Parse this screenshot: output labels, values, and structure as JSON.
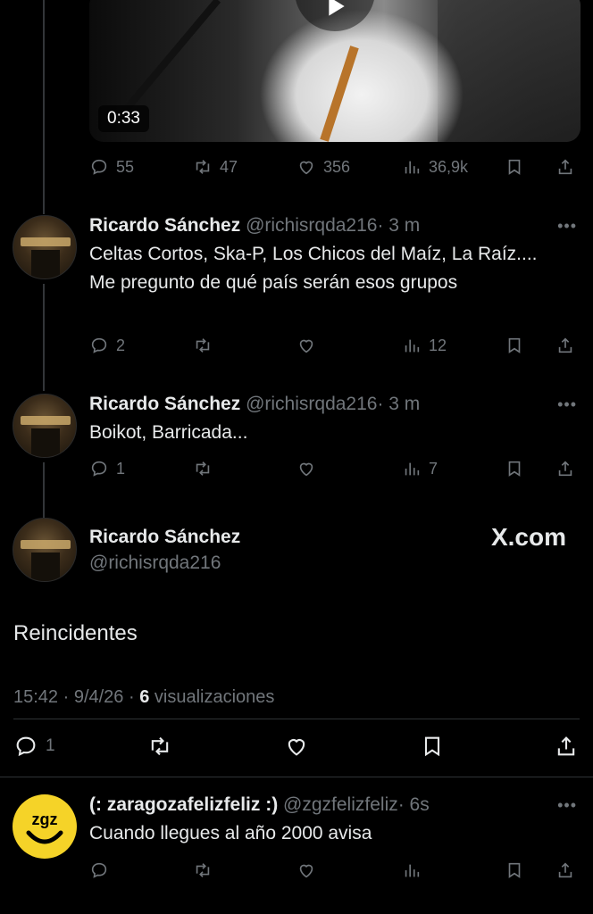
{
  "video": {
    "duration": "0:33"
  },
  "tweet0_stats": {
    "replies": "55",
    "retweets": "47",
    "likes": "356",
    "views": "36,9k"
  },
  "replies": [
    {
      "name": "Ricardo Sánchez",
      "handle": "@richisrqda216",
      "time": "· 3 m",
      "text": "Celtas Cortos, Ska-P, Los Chicos del Maíz, La Raíz.... Me pregunto de qué país serán esos grupos",
      "replies": "2",
      "views": "12"
    },
    {
      "name": "Ricardo Sánchez",
      "handle": "@richisrqda216",
      "time": "· 3 m",
      "text": "Boikot, Barricada...",
      "replies": "1",
      "views": "7"
    }
  ],
  "focused": {
    "name": "Ricardo Sánchez",
    "handle": "@richisrqda216",
    "watermark": "X.com",
    "text": "Reincidentes",
    "time": "15:42 · 9/4/26 · ",
    "views_count": "6",
    "views_label": " visualizaciones",
    "replies": "1"
  },
  "reply_zgz": {
    "name": "(: zaragozafelizfeliz :)",
    "handle": "@zgzfelizfeliz",
    "time": "· 6s",
    "text": "Cuando llegues al año 2000 avisa",
    "avatar_text": "zgz"
  },
  "more_glyph": "•••",
  "icons": [
    "reply-icon",
    "retweet-icon",
    "like-icon",
    "views-icon",
    "bookmark-icon",
    "share-icon",
    "play-icon",
    "more-icon"
  ],
  "colors": {
    "background": "#000000",
    "text": "#e7e9ea",
    "muted": "#71767b",
    "zgz_yellow": "#f5d328"
  }
}
